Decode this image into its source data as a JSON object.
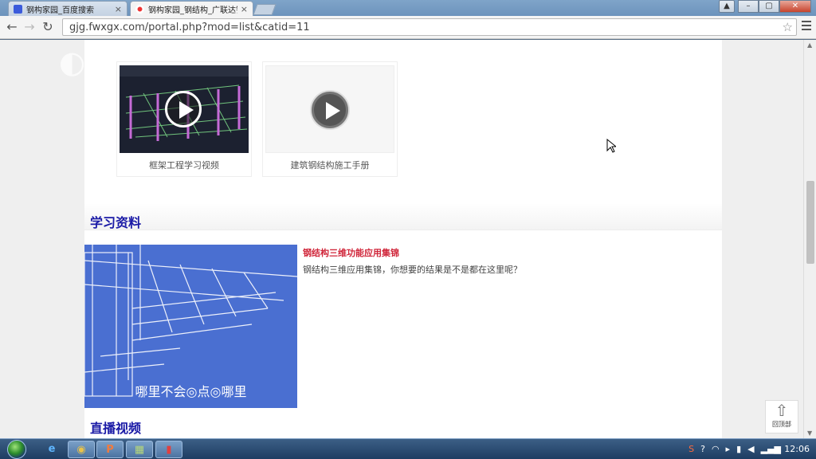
{
  "browser": {
    "tabs": [
      {
        "title": "钢构家园_百度搜索",
        "active": false,
        "icon": "baidu-paw-icon"
      },
      {
        "title": "钢构家园_钢结构_广联达钢",
        "active": true,
        "icon": "site-favicon-icon"
      }
    ],
    "tab_close": "×",
    "url": "gjg.fwxgx.com/portal.php?mod=list&catid=11",
    "window_controls": {
      "user": "▲",
      "minimize": "–",
      "maximize": "▢",
      "close": "✕"
    }
  },
  "page": {
    "watermark": "◐",
    "videos": [
      {
        "caption": "框架工程学习视频",
        "thumb": "dark-3d-frame-model"
      },
      {
        "caption": "建筑钢结构施工手册",
        "thumb": "blank"
      }
    ],
    "sections": [
      {
        "title": "学习资料"
      },
      {
        "title": "直播视频"
      }
    ],
    "article": {
      "title": "钢结构三维功能应用集锦",
      "description": "钢结构三维应用集锦，你想要的结果是不是都在这里呢？",
      "image_slogan": "哪里不会◎点◎哪里"
    },
    "back_to_top": "回顶部"
  },
  "taskbar": {
    "items": [
      {
        "icon": "ie-icon",
        "glyph": "e",
        "active": false
      },
      {
        "icon": "chrome-icon",
        "glyph": "◉",
        "active": true
      },
      {
        "icon": "powerpoint-icon",
        "glyph": "P",
        "active": false
      },
      {
        "icon": "app-icon",
        "glyph": "▦",
        "active": false
      },
      {
        "icon": "app2-icon",
        "glyph": "▮",
        "active": false
      }
    ],
    "clock": "12:06"
  }
}
